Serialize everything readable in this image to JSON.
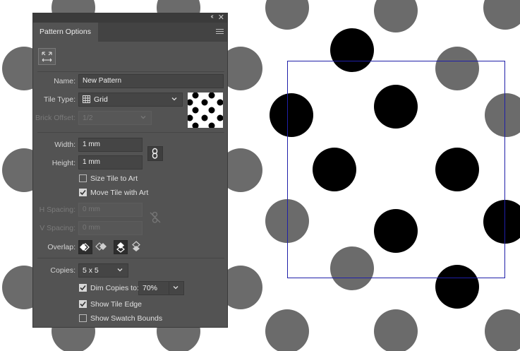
{
  "panel": {
    "tab_title": "Pattern Options",
    "collapse_glyph": "‹‹",
    "close_glyph": "✕",
    "edit_tile_icon": "pattern-tile-tool-icon",
    "name_label": "Name:",
    "name_value": "New Pattern",
    "tile_type_label": "Tile Type:",
    "tile_type_value": "Grid",
    "brick_offset_label": "Brick Offset:",
    "brick_offset_value": "1/2",
    "width_label": "Width:",
    "width_value": "1 mm",
    "height_label": "Height:",
    "height_value": "1 mm",
    "size_tile_label": "Size Tile to Art",
    "size_tile_checked": false,
    "move_tile_label": "Move Tile with Art",
    "move_tile_checked": true,
    "h_spacing_label": "H Spacing:",
    "h_spacing_value": "0 mm",
    "v_spacing_label": "V Spacing:",
    "v_spacing_value": "0 mm",
    "overlap_label": "Overlap:",
    "overlap_buttons": [
      "left-in-front",
      "right-in-front",
      "top-in-front",
      "bottom-in-front"
    ],
    "copies_label": "Copies:",
    "copies_value": "5 x 5",
    "dim_copies_label": "Dim Copies to:",
    "dim_copies_checked": true,
    "dim_copies_value": "70%",
    "show_tile_edge_label": "Show Tile Edge",
    "show_tile_edge_checked": true,
    "show_swatch_bounds_label": "Show Swatch Bounds",
    "show_swatch_bounds_checked": false
  },
  "colors": {
    "panel_bg": "#535353",
    "dot_primary": "#000000",
    "dot_copy": "#6b6b6b",
    "tile_edge": "#1f1fa8"
  }
}
